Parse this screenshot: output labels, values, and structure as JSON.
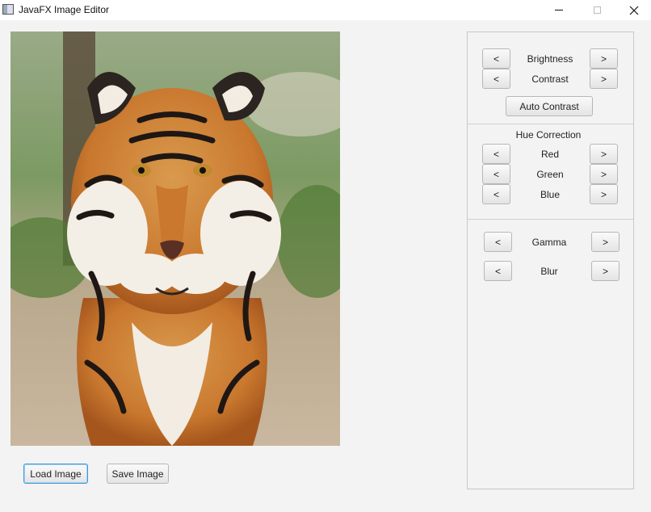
{
  "window": {
    "title": "JavaFX Image Editor"
  },
  "image": {
    "subject": "tiger"
  },
  "bottom": {
    "load_label": "Load Image",
    "save_label": "Save Image"
  },
  "controls": {
    "decrease": "<",
    "increase": ">",
    "brightness": "Brightness",
    "contrast": "Contrast",
    "auto_contrast": "Auto Contrast",
    "hue_title": "Hue Correction",
    "red": "Red",
    "green": "Green",
    "blue": "Blue",
    "gamma": "Gamma",
    "blur": "Blur"
  }
}
